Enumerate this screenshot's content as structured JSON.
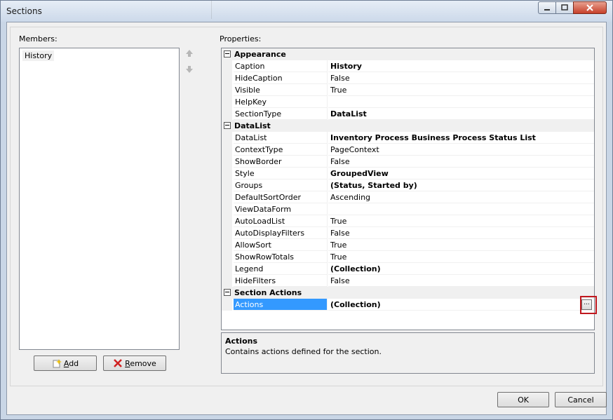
{
  "window": {
    "title": "Sections"
  },
  "members": {
    "label": "Members:",
    "items": [
      "History"
    ]
  },
  "buttons": {
    "add": "Add",
    "remove": "Remove",
    "ok": "OK",
    "cancel": "Cancel",
    "ellipsis": "..."
  },
  "properties": {
    "label": "Properties:",
    "categories": [
      {
        "name": "Appearance",
        "rows": [
          {
            "name": "Caption",
            "value": "History",
            "bold": true
          },
          {
            "name": "HideCaption",
            "value": "False",
            "bold": false
          },
          {
            "name": "Visible",
            "value": "True",
            "bold": false
          },
          {
            "name": "HelpKey",
            "value": "",
            "bold": false
          },
          {
            "name": "SectionType",
            "value": "DataList",
            "bold": true
          }
        ]
      },
      {
        "name": "DataList",
        "rows": [
          {
            "name": "DataList",
            "value": "Inventory Process Business Process Status List",
            "bold": true
          },
          {
            "name": "ContextType",
            "value": "PageContext",
            "bold": false
          },
          {
            "name": "ShowBorder",
            "value": "False",
            "bold": false
          },
          {
            "name": "Style",
            "value": "GroupedView",
            "bold": true
          },
          {
            "name": "Groups",
            "value": "(Status, Started by)",
            "bold": true
          },
          {
            "name": "DefaultSortOrder",
            "value": "Ascending",
            "bold": false
          },
          {
            "name": "ViewDataForm",
            "value": "",
            "bold": false
          },
          {
            "name": "AutoLoadList",
            "value": "True",
            "bold": false
          },
          {
            "name": "AutoDisplayFilters",
            "value": "False",
            "bold": false
          },
          {
            "name": "AllowSort",
            "value": "True",
            "bold": false
          },
          {
            "name": "ShowRowTotals",
            "value": "True",
            "bold": false
          },
          {
            "name": "Legend",
            "value": "(Collection)",
            "bold": true
          },
          {
            "name": "HideFilters",
            "value": "False",
            "bold": false
          }
        ]
      },
      {
        "name": "Section Actions",
        "rows": [
          {
            "name": "Actions",
            "value": "(Collection)",
            "bold": true,
            "selected": true
          }
        ]
      }
    ]
  },
  "description": {
    "title": "Actions",
    "text": "Contains actions defined for the section."
  },
  "colors": {
    "selection": "#3399ff",
    "highlight_box": "#c0181e"
  }
}
